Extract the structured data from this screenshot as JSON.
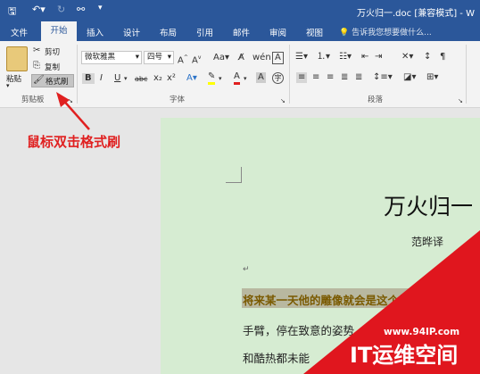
{
  "window": {
    "title": "万火归一.doc [兼容模式] - W"
  },
  "tabs": [
    "文件",
    "开始",
    "插入",
    "设计",
    "布局",
    "引用",
    "邮件",
    "审阅",
    "视图"
  ],
  "tell_me": "告诉我您想要做什么...",
  "clipboard": {
    "paste": "粘贴",
    "cut": "剪切",
    "copy": "复制",
    "format_painter": "格式刷",
    "group": "剪贴板"
  },
  "font": {
    "name": "微软雅黑",
    "size": "四号",
    "group": "字体",
    "format_buttons": [
      "B",
      "I",
      "U",
      "abc",
      "x₂",
      "x²"
    ]
  },
  "paragraph": {
    "group": "段落"
  },
  "annotation": "鼠标双击格式刷",
  "document": {
    "title": "万火归一",
    "author": "范晔译",
    "line1": "将来某一天他的雕像就会是这个样",
    "line2": "手臂，停在致意的姿势",
    "line3": "和酷热都未能"
  },
  "watermark": {
    "url": "www.94IP.com",
    "brand": "IT运维空间"
  },
  "colors": {
    "accent": "#2b579a",
    "annotation": "#e02020",
    "page_bg": "#d6ecd2",
    "watermark": "#e0161e"
  }
}
